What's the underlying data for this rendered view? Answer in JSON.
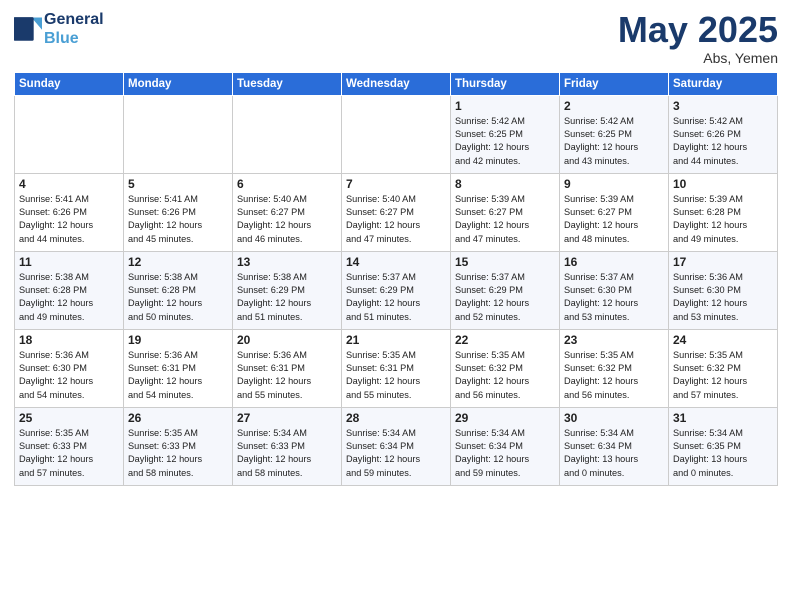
{
  "logo": {
    "line1": "General",
    "line2": "Blue"
  },
  "title": "May 2025",
  "location": "Abs, Yemen",
  "days_of_week": [
    "Sunday",
    "Monday",
    "Tuesday",
    "Wednesday",
    "Thursday",
    "Friday",
    "Saturday"
  ],
  "weeks": [
    [
      {
        "day": "",
        "info": ""
      },
      {
        "day": "",
        "info": ""
      },
      {
        "day": "",
        "info": ""
      },
      {
        "day": "",
        "info": ""
      },
      {
        "day": "1",
        "info": "Sunrise: 5:42 AM\nSunset: 6:25 PM\nDaylight: 12 hours\nand 42 minutes."
      },
      {
        "day": "2",
        "info": "Sunrise: 5:42 AM\nSunset: 6:25 PM\nDaylight: 12 hours\nand 43 minutes."
      },
      {
        "day": "3",
        "info": "Sunrise: 5:42 AM\nSunset: 6:26 PM\nDaylight: 12 hours\nand 44 minutes."
      }
    ],
    [
      {
        "day": "4",
        "info": "Sunrise: 5:41 AM\nSunset: 6:26 PM\nDaylight: 12 hours\nand 44 minutes."
      },
      {
        "day": "5",
        "info": "Sunrise: 5:41 AM\nSunset: 6:26 PM\nDaylight: 12 hours\nand 45 minutes."
      },
      {
        "day": "6",
        "info": "Sunrise: 5:40 AM\nSunset: 6:27 PM\nDaylight: 12 hours\nand 46 minutes."
      },
      {
        "day": "7",
        "info": "Sunrise: 5:40 AM\nSunset: 6:27 PM\nDaylight: 12 hours\nand 47 minutes."
      },
      {
        "day": "8",
        "info": "Sunrise: 5:39 AM\nSunset: 6:27 PM\nDaylight: 12 hours\nand 47 minutes."
      },
      {
        "day": "9",
        "info": "Sunrise: 5:39 AM\nSunset: 6:27 PM\nDaylight: 12 hours\nand 48 minutes."
      },
      {
        "day": "10",
        "info": "Sunrise: 5:39 AM\nSunset: 6:28 PM\nDaylight: 12 hours\nand 49 minutes."
      }
    ],
    [
      {
        "day": "11",
        "info": "Sunrise: 5:38 AM\nSunset: 6:28 PM\nDaylight: 12 hours\nand 49 minutes."
      },
      {
        "day": "12",
        "info": "Sunrise: 5:38 AM\nSunset: 6:28 PM\nDaylight: 12 hours\nand 50 minutes."
      },
      {
        "day": "13",
        "info": "Sunrise: 5:38 AM\nSunset: 6:29 PM\nDaylight: 12 hours\nand 51 minutes."
      },
      {
        "day": "14",
        "info": "Sunrise: 5:37 AM\nSunset: 6:29 PM\nDaylight: 12 hours\nand 51 minutes."
      },
      {
        "day": "15",
        "info": "Sunrise: 5:37 AM\nSunset: 6:29 PM\nDaylight: 12 hours\nand 52 minutes."
      },
      {
        "day": "16",
        "info": "Sunrise: 5:37 AM\nSunset: 6:30 PM\nDaylight: 12 hours\nand 53 minutes."
      },
      {
        "day": "17",
        "info": "Sunrise: 5:36 AM\nSunset: 6:30 PM\nDaylight: 12 hours\nand 53 minutes."
      }
    ],
    [
      {
        "day": "18",
        "info": "Sunrise: 5:36 AM\nSunset: 6:30 PM\nDaylight: 12 hours\nand 54 minutes."
      },
      {
        "day": "19",
        "info": "Sunrise: 5:36 AM\nSunset: 6:31 PM\nDaylight: 12 hours\nand 54 minutes."
      },
      {
        "day": "20",
        "info": "Sunrise: 5:36 AM\nSunset: 6:31 PM\nDaylight: 12 hours\nand 55 minutes."
      },
      {
        "day": "21",
        "info": "Sunrise: 5:35 AM\nSunset: 6:31 PM\nDaylight: 12 hours\nand 55 minutes."
      },
      {
        "day": "22",
        "info": "Sunrise: 5:35 AM\nSunset: 6:32 PM\nDaylight: 12 hours\nand 56 minutes."
      },
      {
        "day": "23",
        "info": "Sunrise: 5:35 AM\nSunset: 6:32 PM\nDaylight: 12 hours\nand 56 minutes."
      },
      {
        "day": "24",
        "info": "Sunrise: 5:35 AM\nSunset: 6:32 PM\nDaylight: 12 hours\nand 57 minutes."
      }
    ],
    [
      {
        "day": "25",
        "info": "Sunrise: 5:35 AM\nSunset: 6:33 PM\nDaylight: 12 hours\nand 57 minutes."
      },
      {
        "day": "26",
        "info": "Sunrise: 5:35 AM\nSunset: 6:33 PM\nDaylight: 12 hours\nand 58 minutes."
      },
      {
        "day": "27",
        "info": "Sunrise: 5:34 AM\nSunset: 6:33 PM\nDaylight: 12 hours\nand 58 minutes."
      },
      {
        "day": "28",
        "info": "Sunrise: 5:34 AM\nSunset: 6:34 PM\nDaylight: 12 hours\nand 59 minutes."
      },
      {
        "day": "29",
        "info": "Sunrise: 5:34 AM\nSunset: 6:34 PM\nDaylight: 12 hours\nand 59 minutes."
      },
      {
        "day": "30",
        "info": "Sunrise: 5:34 AM\nSunset: 6:34 PM\nDaylight: 13 hours\nand 0 minutes."
      },
      {
        "day": "31",
        "info": "Sunrise: 5:34 AM\nSunset: 6:35 PM\nDaylight: 13 hours\nand 0 minutes."
      }
    ]
  ]
}
